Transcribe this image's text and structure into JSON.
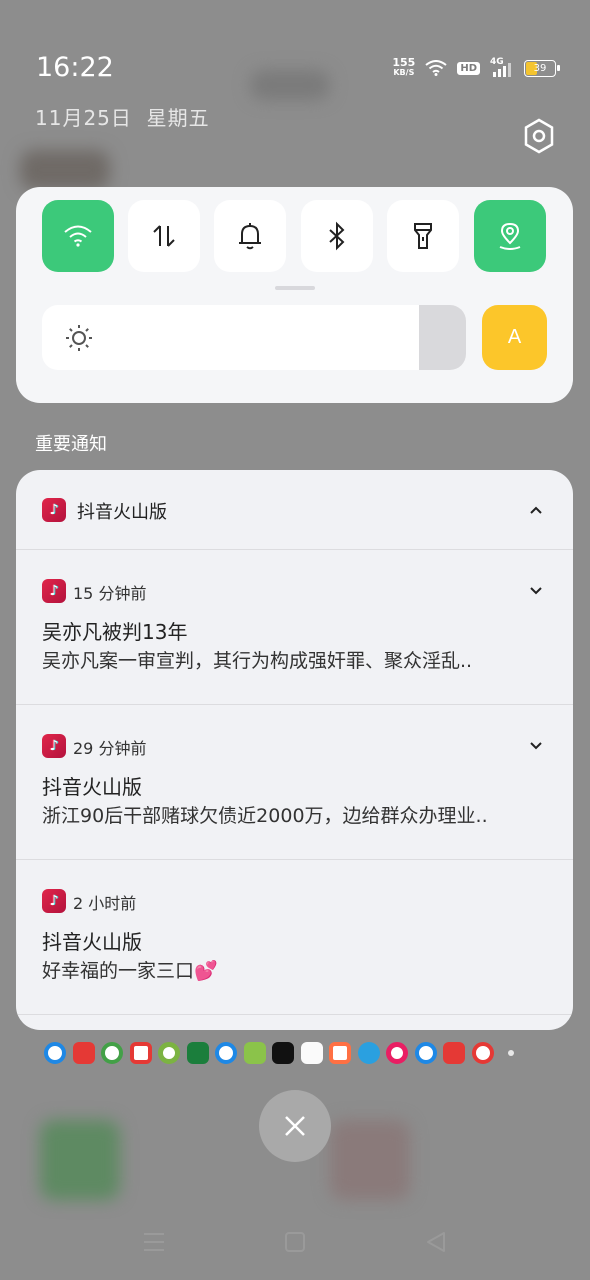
{
  "status_bar": {
    "time": "16:22",
    "date": "11月25日",
    "weekday": "星期五",
    "net_speed_value": "155",
    "net_speed_unit": "KB/S",
    "hd_label": "HD",
    "network_label": "4G",
    "battery_level": "39"
  },
  "quick_settings": {
    "tiles": [
      {
        "name": "wifi",
        "icon": "wifi-icon",
        "on": true
      },
      {
        "name": "mobile-data",
        "icon": "data-arrows-icon",
        "on": false
      },
      {
        "name": "sound",
        "icon": "bell-icon",
        "on": false
      },
      {
        "name": "bluetooth",
        "icon": "bluetooth-icon",
        "on": false
      },
      {
        "name": "flashlight",
        "icon": "flashlight-icon",
        "on": false
      },
      {
        "name": "location",
        "icon": "location-icon",
        "on": true
      }
    ],
    "brightness_level": 0.92,
    "auto_brightness_label": "A",
    "accent_on": "#3cc97a",
    "accent_auto": "#fcc62a"
  },
  "notifications": {
    "section_title": "重要通知",
    "app_name": "抖音火山版",
    "items": [
      {
        "time": "15 分钟前",
        "title": "吴亦凡被判13年",
        "text": "吴亦凡案一审宣判，其行为构成强奸罪、聚众淫乱..",
        "expandable": true
      },
      {
        "time": "29 分钟前",
        "title": "抖音火山版",
        "text": "浙江90后干部赌球欠债近2000万，边给群众办理业..",
        "expandable": true
      },
      {
        "time": "2 小时前",
        "title": "抖音火山版",
        "text": "好幸福的一家三口💕",
        "expandable": false
      }
    ]
  },
  "notification_app_icons": [
    "tv-icon",
    "shop-icon",
    "video-play-icon",
    "music-icon",
    "fruit-icon",
    "oppo-icon",
    "browser-icon",
    "points-icon",
    "camera-icon",
    "blank-icon",
    "game-icon",
    "telegram-icon",
    "media-icon",
    "browser-icon-2",
    "red-app-icon",
    "avatar-icon"
  ]
}
